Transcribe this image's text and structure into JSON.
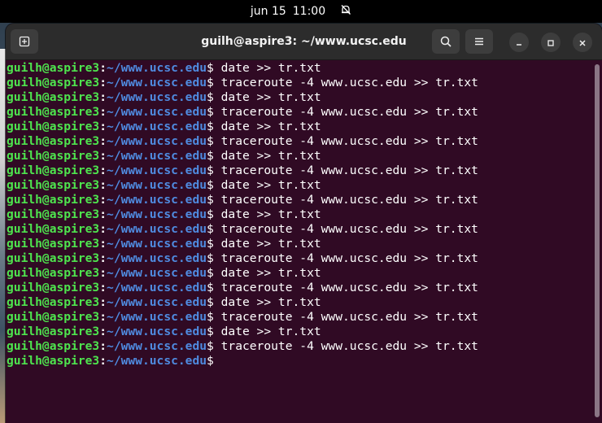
{
  "topbar": {
    "date": "jun 15",
    "time": "11:00"
  },
  "window": {
    "title": "guilh@aspire3: ~/www.ucsc.edu"
  },
  "prompt": {
    "user": "guilh@aspire3",
    "colon": ":",
    "path": "~/www.ucsc.edu",
    "symbol": "$"
  },
  "terminal": {
    "lines": [
      " date >> tr.txt",
      " traceroute -4 www.ucsc.edu >> tr.txt",
      " date >> tr.txt",
      " traceroute -4 www.ucsc.edu >> tr.txt",
      " date >> tr.txt",
      " traceroute -4 www.ucsc.edu >> tr.txt",
      " date >> tr.txt",
      " traceroute -4 www.ucsc.edu >> tr.txt",
      " date >> tr.txt",
      " traceroute -4 www.ucsc.edu >> tr.txt",
      " date >> tr.txt",
      " traceroute -4 www.ucsc.edu >> tr.txt",
      " date >> tr.txt",
      " traceroute -4 www.ucsc.edu >> tr.txt",
      " date >> tr.txt",
      " traceroute -4 www.ucsc.edu >> tr.txt",
      " date >> tr.txt",
      " traceroute -4 www.ucsc.edu >> tr.txt",
      " date >> tr.txt",
      " traceroute -4 www.ucsc.edu >> tr.txt",
      ""
    ]
  },
  "colors": {
    "terminal_bg": "#300a24",
    "user": "#4ee44e",
    "path": "#4f8be0"
  }
}
